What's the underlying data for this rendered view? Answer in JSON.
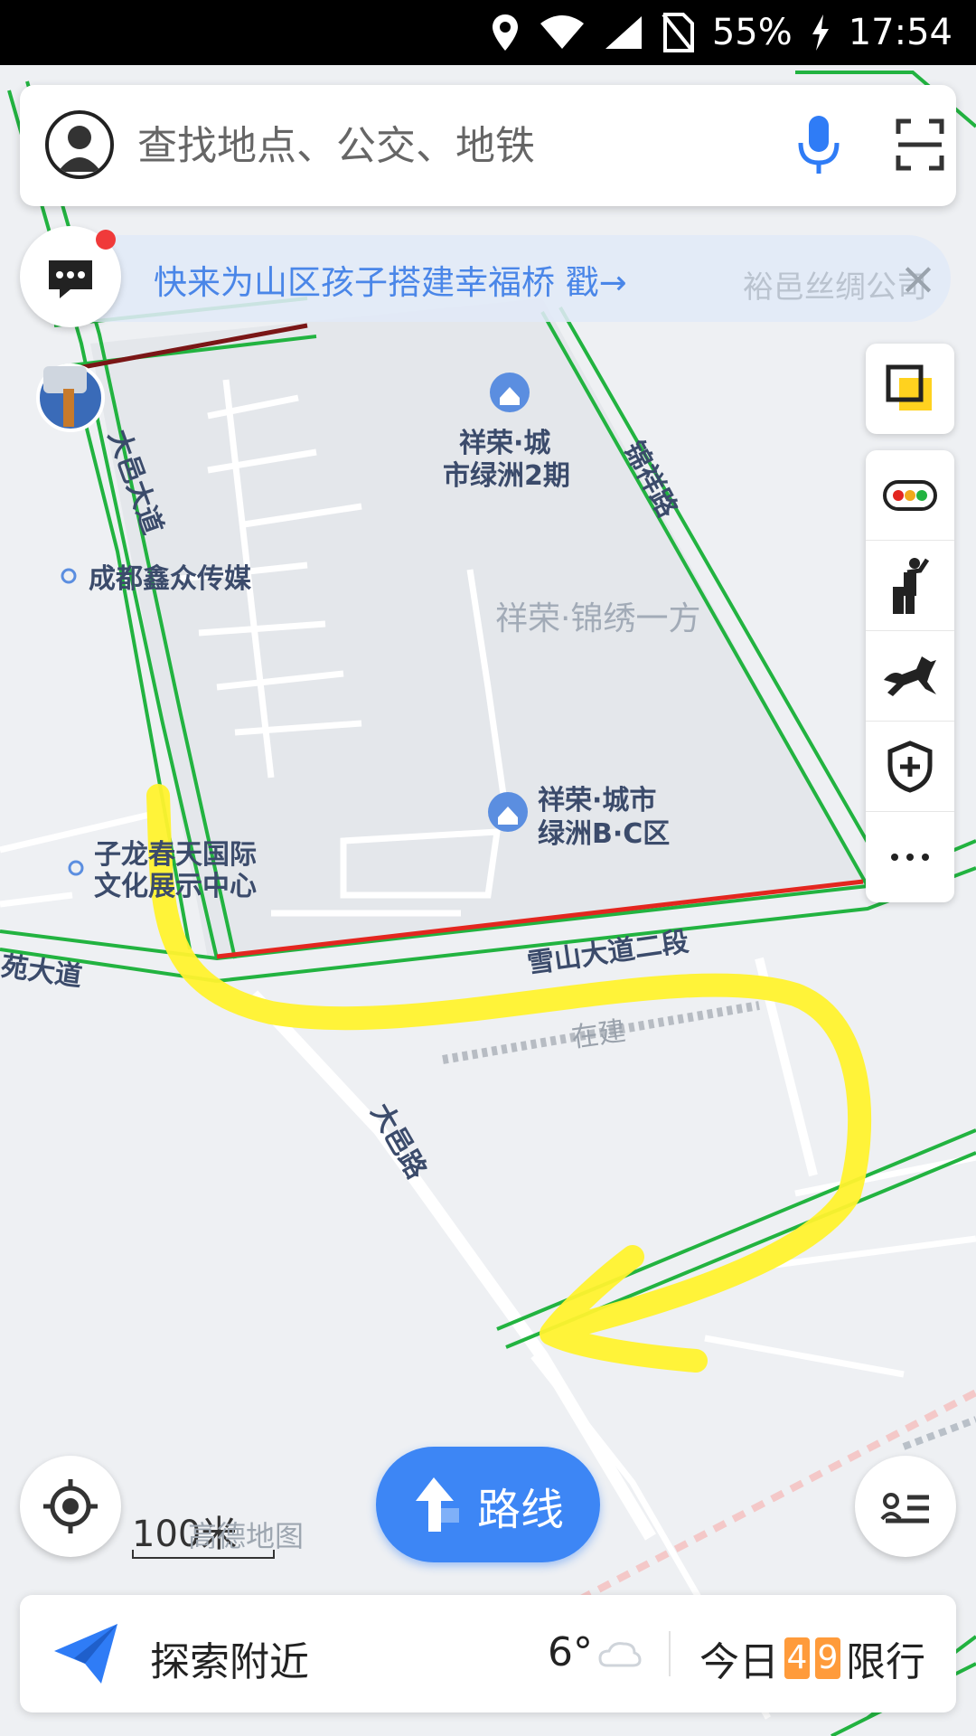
{
  "status_bar": {
    "battery": "55%",
    "time": "17:54"
  },
  "search": {
    "placeholder": "查找地点、公交、地铁"
  },
  "banner": {
    "text": "快来为山区孩子搭建幸福桥 戳→",
    "faded_text": "裕邑丝绸公司",
    "close_icon": "close-icon"
  },
  "map": {
    "labels": {
      "dayi_avenue": "大邑大道",
      "chengdu_media": "成都鑫众传媒",
      "xiangrong_city_2": [
        "祥荣·城",
        "市绿洲2期"
      ],
      "jinxiang_road": "锦祥路",
      "jinxiu_yifang": "祥荣·锦绣一方",
      "xiangrong_bc": [
        "祥荣·城市",
        "绿洲B·C区"
      ],
      "zilong_center": [
        "子龙春天国际",
        "文化展示中心"
      ],
      "yuan_avenue": "苑大道",
      "xueshan_avenue": "雪山大道二段",
      "under_construction": "在建",
      "dayi_road": "大邑路"
    },
    "colors": {
      "road_green": "#22b340",
      "road_red": "#e3261f",
      "highlight_yellow": "#fff22e",
      "poi_blue": "#5b8ee0"
    }
  },
  "scale": {
    "text": "100米",
    "brand": "高德地图"
  },
  "route_button": {
    "label": "路线"
  },
  "bottom_bar": {
    "explore_label": "探索附近",
    "temperature": "6°",
    "weather_icon": "cloud-icon",
    "limit_prefix": "今日",
    "limit_digit_1": "4",
    "limit_digit_2": "9",
    "limit_suffix": "限行"
  },
  "right_tools": [
    "layers-icon",
    "traffic-icon",
    "pedestrian-icon",
    "horse-icon",
    "shield-plus-icon",
    "more-icon"
  ]
}
